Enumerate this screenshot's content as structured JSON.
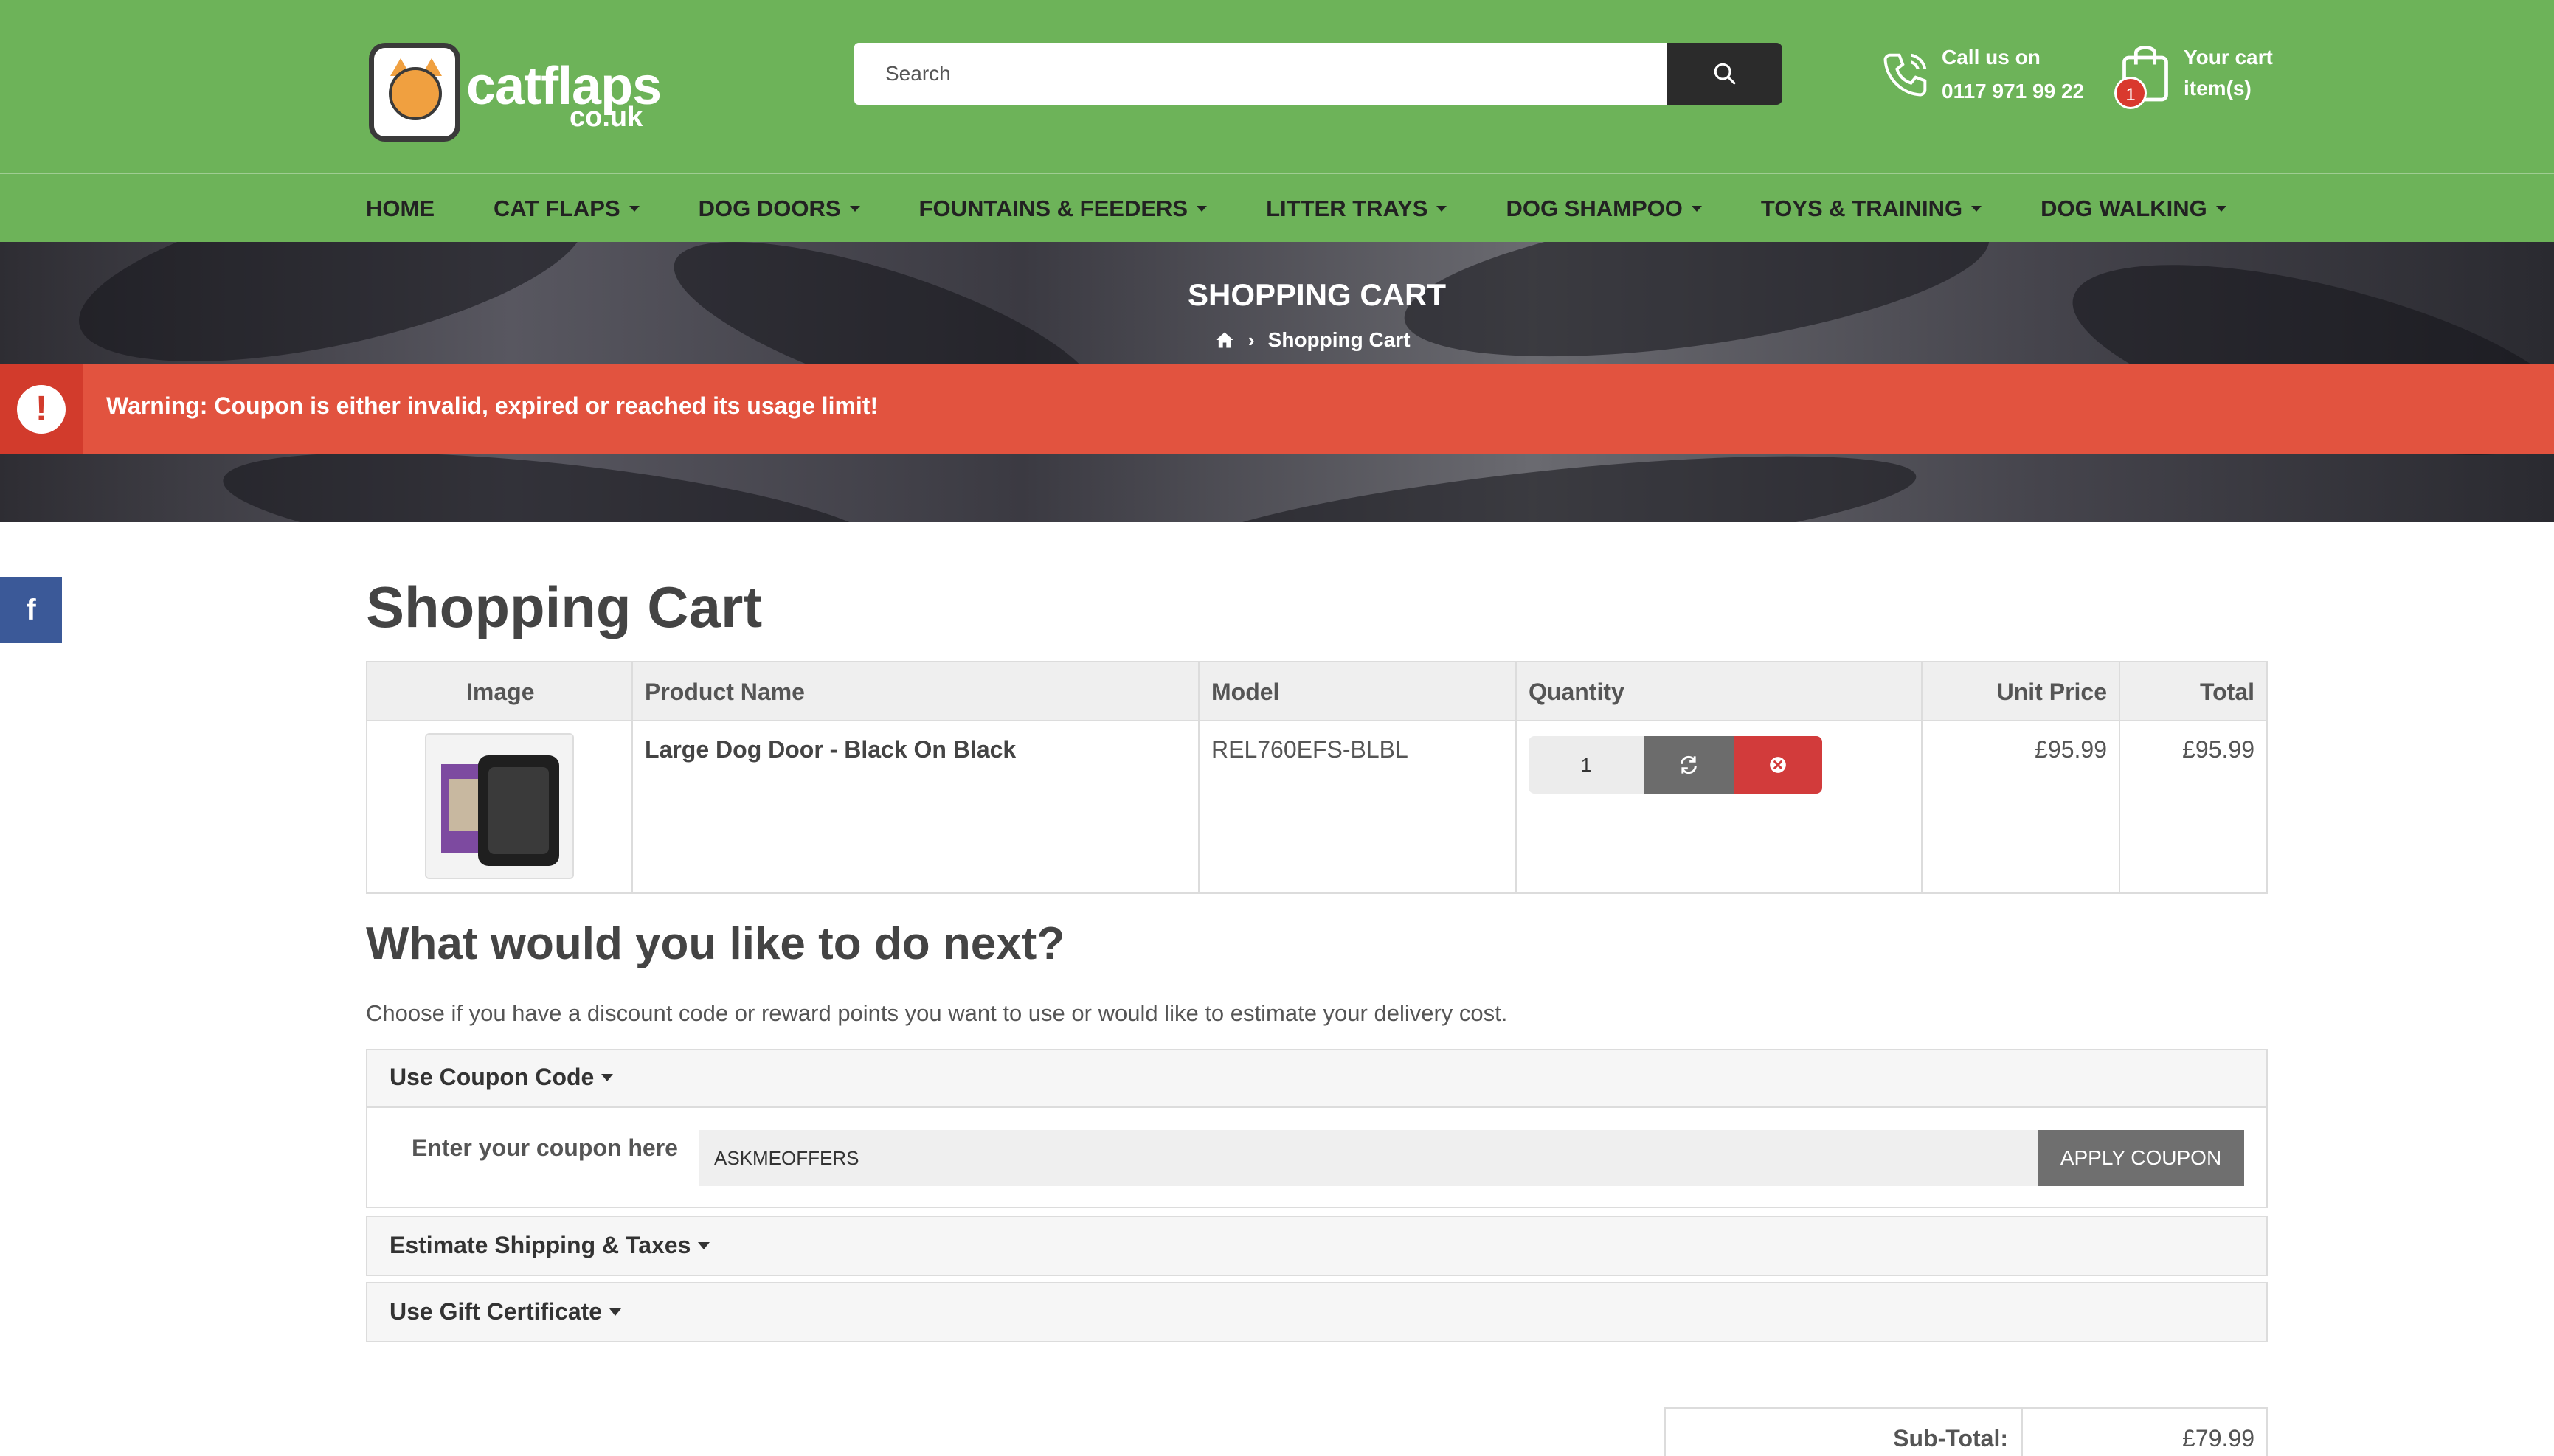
{
  "header": {
    "logo": {
      "brand": "catflaps",
      "domain": "co.uk"
    },
    "search": {
      "placeholder": "Search"
    },
    "call": {
      "line1": "Call us on",
      "line2": "0117 971 99 22"
    },
    "cart": {
      "count": "1",
      "line1": "Your cart",
      "line2": "item(s)"
    }
  },
  "nav": {
    "items": [
      {
        "label": "HOME",
        "has_dropdown": false
      },
      {
        "label": "CAT FLAPS",
        "has_dropdown": true
      },
      {
        "label": "DOG DOORS",
        "has_dropdown": true
      },
      {
        "label": "FOUNTAINS & FEEDERS",
        "has_dropdown": true
      },
      {
        "label": "LITTER TRAYS",
        "has_dropdown": true
      },
      {
        "label": "DOG SHAMPOO",
        "has_dropdown": true
      },
      {
        "label": "TOYS & TRAINING",
        "has_dropdown": true
      },
      {
        "label": "DOG WALKING",
        "has_dropdown": true
      }
    ]
  },
  "banner": {
    "title": "SHOPPING CART",
    "breadcrumb": {
      "current": "Shopping Cart"
    }
  },
  "alert": {
    "message": "Warning: Coupon is either invalid, expired or reached its usage limit!"
  },
  "social": {
    "facebook": "f"
  },
  "cart_page": {
    "title": "Shopping Cart",
    "table": {
      "headers": {
        "image": "Image",
        "product_name": "Product Name",
        "model": "Model",
        "quantity": "Quantity",
        "unit_price": "Unit Price",
        "total": "Total"
      },
      "rows": [
        {
          "product_name": "Large Dog Door - Black On Black",
          "model": "REL760EFS-BLBL",
          "quantity": "1",
          "unit_price": "£95.99",
          "total": "£95.99"
        }
      ]
    },
    "next": {
      "title": "What would you like to do next?",
      "description": "Choose if you have a discount code or reward points you want to use or would like to estimate your delivery cost."
    },
    "coupon": {
      "heading": "Use Coupon Code",
      "label": "Enter your coupon here",
      "value": "ASKMEOFFERS",
      "button": "APPLY COUPON"
    },
    "shipping": {
      "heading": "Estimate Shipping & Taxes"
    },
    "gift": {
      "heading": "Use Gift Certificate"
    },
    "totals": {
      "subtotal_label": "Sub-Total:",
      "subtotal_value": "£79.99"
    }
  },
  "colors": {
    "header_green": "#6db359",
    "alert_red": "#e2533f",
    "facebook_blue": "#3b5998",
    "remove_red": "#d23b3b"
  }
}
